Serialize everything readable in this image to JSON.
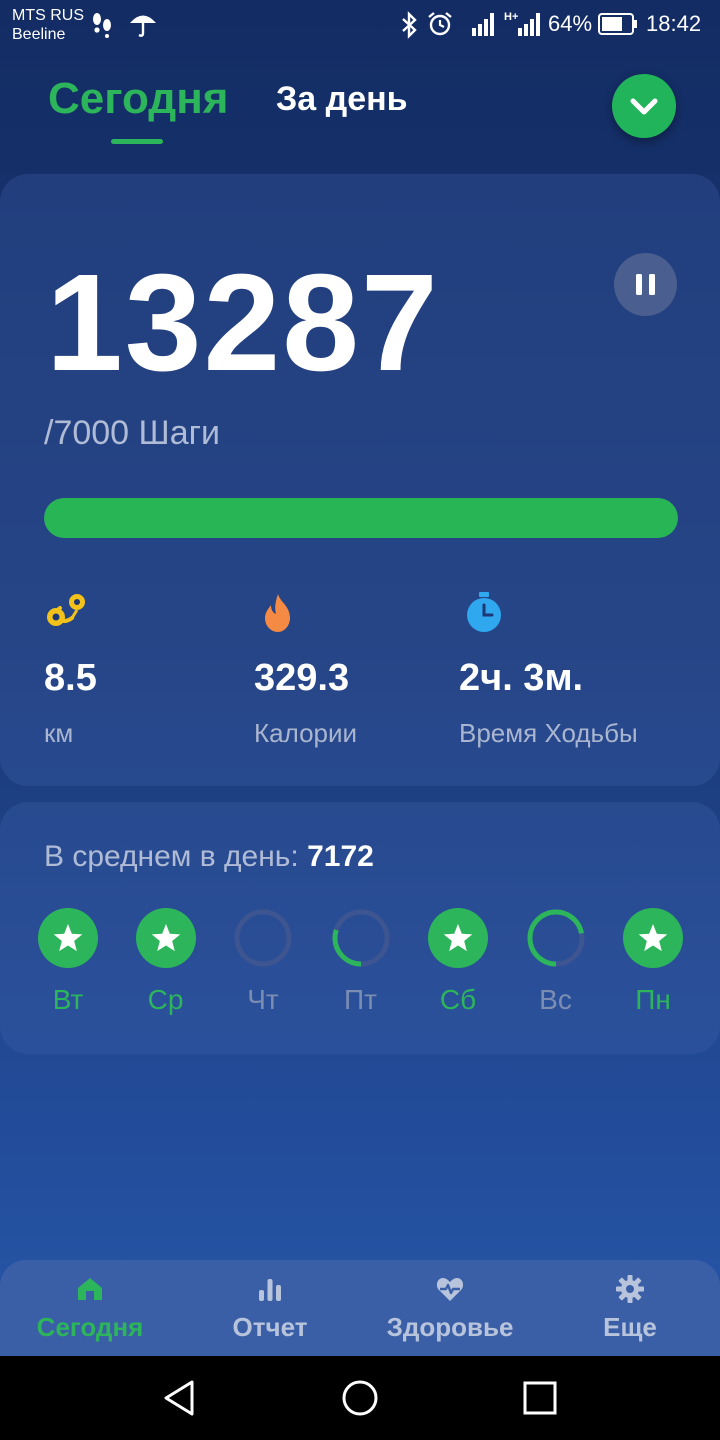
{
  "status_bar": {
    "carrier_1": "MTS RUS",
    "carrier_2": "Beeline",
    "battery": "64%",
    "time": "18:42",
    "network": "H+"
  },
  "header": {
    "tab_today": "Сегодня",
    "tab_day": "За день"
  },
  "summary": {
    "steps": "13287",
    "goal_text": "/7000 Шаги",
    "progress_percent": 100
  },
  "stats": [
    {
      "icon": "route-icon",
      "value": "8.5",
      "label": "км",
      "color": "#f2c21b"
    },
    {
      "icon": "flame-icon",
      "value": "329.3",
      "label": "Калории",
      "color": "#f58a45"
    },
    {
      "icon": "stopwatch-icon",
      "value": "2ч. 3м.",
      "label": "Время Ходьбы",
      "color": "#2fa8f0"
    }
  ],
  "week": {
    "avg_label": "В среднем в день: ",
    "avg_value": "7172",
    "days": [
      {
        "label": "Вт",
        "status": "done",
        "progress": 1.0
      },
      {
        "label": "Ср",
        "status": "done",
        "progress": 1.0
      },
      {
        "label": "Чт",
        "status": "todo",
        "progress": 0.0
      },
      {
        "label": "Пт",
        "status": "todo",
        "progress": 0.3
      },
      {
        "label": "Сб",
        "status": "done",
        "progress": 1.0
      },
      {
        "label": "Вс",
        "status": "todo",
        "progress": 0.72
      },
      {
        "label": "Пн",
        "status": "done",
        "progress": 1.0
      }
    ]
  },
  "bottom_nav": {
    "items": [
      {
        "label": "Сегодня",
        "icon": "home-icon",
        "active": true
      },
      {
        "label": "Отчет",
        "icon": "bar-chart-icon",
        "active": false
      },
      {
        "label": "Здоровье",
        "icon": "heart-pulse-icon",
        "active": false
      },
      {
        "label": "Еще",
        "icon": "gear-icon",
        "active": false
      }
    ]
  },
  "colors": {
    "accent_green": "#2cb55a",
    "background_top": "#132c64",
    "background_bottom": "#285aa8"
  }
}
